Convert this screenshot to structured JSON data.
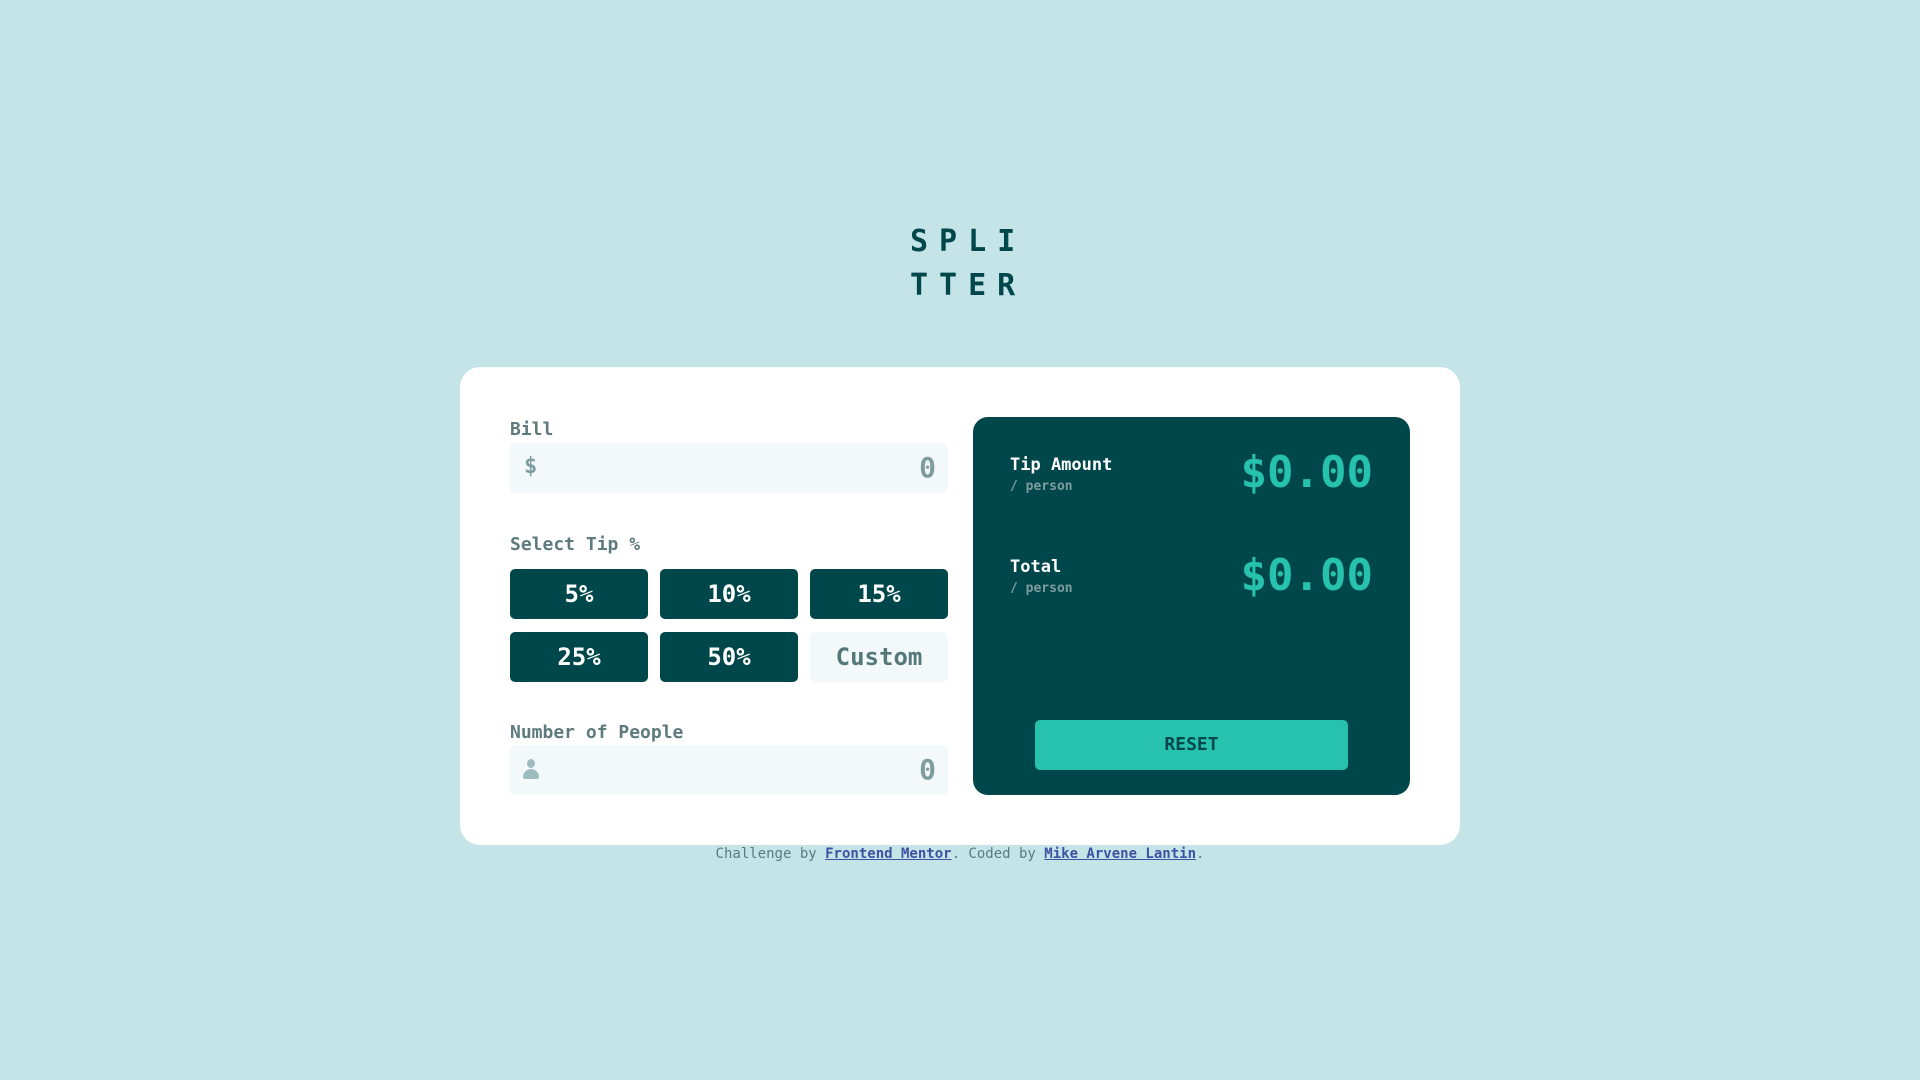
{
  "logo": {
    "line1": "SPLI",
    "line2": "TTER"
  },
  "bill": {
    "label": "Bill",
    "currency_symbol": "$",
    "value": "0"
  },
  "tip": {
    "label": "Select Tip %",
    "options": [
      "5%",
      "10%",
      "15%",
      "25%",
      "50%"
    ],
    "custom_placeholder": "Custom"
  },
  "people": {
    "label": "Number of People",
    "value": "0",
    "icon": "person-icon"
  },
  "results": {
    "tip_amount_title": "Tip Amount",
    "tip_amount_sub": "/ person",
    "tip_amount_value": "$0.00",
    "total_title": "Total",
    "total_sub": "/ person",
    "total_value": "$0.00",
    "reset_label": "RESET"
  },
  "attribution": {
    "prefix": "Challenge by ",
    "link1": "Frontend Mentor",
    "middle": ". Coded by ",
    "link2": "Mike Arvene Lantin",
    "suffix": "."
  },
  "colors": {
    "background": "#c5e4e7",
    "dark_cyan": "#00474b",
    "accent": "#26c2ae",
    "card": "#ffffff",
    "input_bg": "#f3f9fa"
  }
}
